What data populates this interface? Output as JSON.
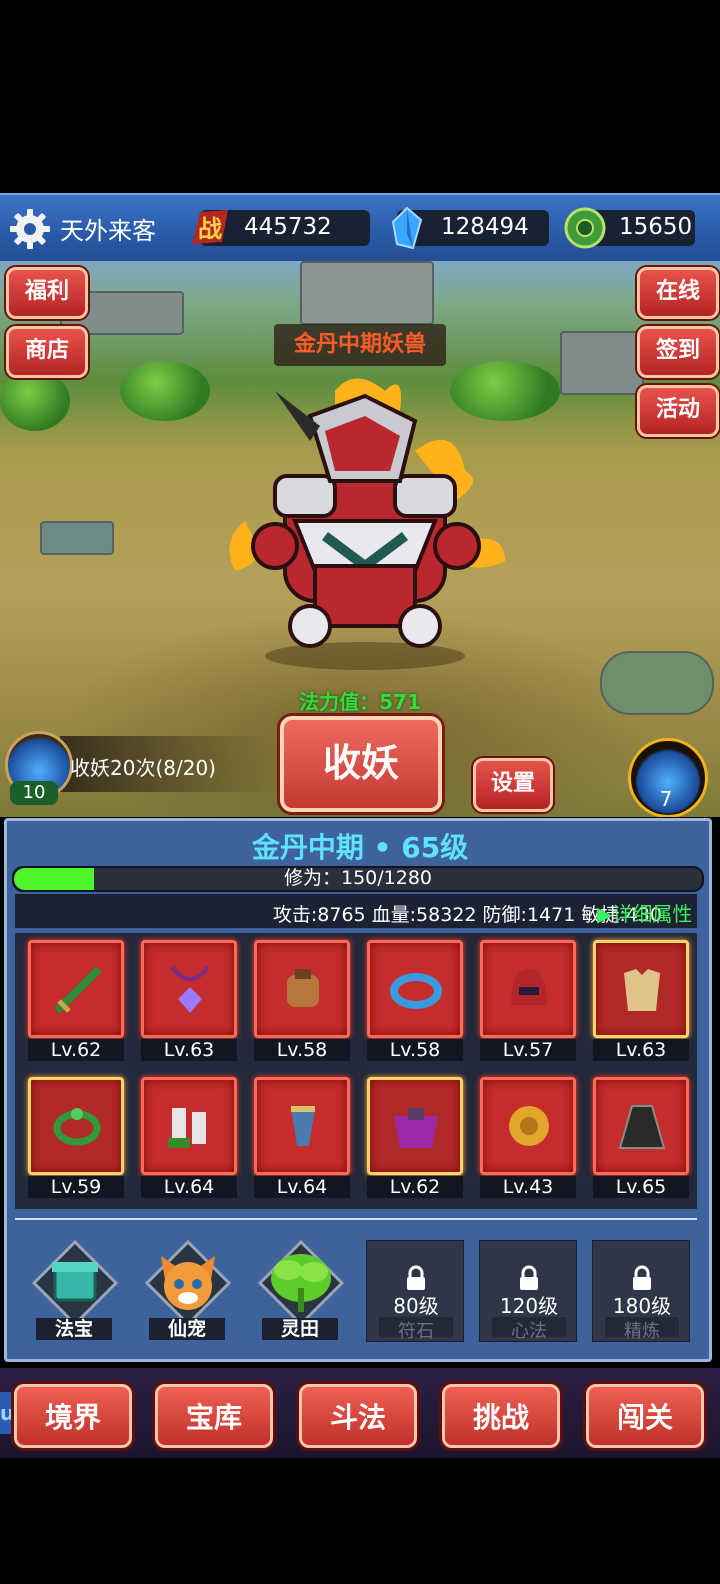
{
  "player": {
    "name": "天外来客"
  },
  "resources": [
    {
      "icon": "battle-power-icon",
      "value": "445732"
    },
    {
      "icon": "crystal-gem-icon",
      "value": "128494"
    },
    {
      "icon": "jade-coin-icon",
      "value": "15650"
    }
  ],
  "scene": {
    "left_buttons": [
      "福利",
      "商店"
    ],
    "right_buttons": [
      "在线",
      "签到",
      "活动"
    ],
    "monster_name": "金丹中期妖兽",
    "power_label": "法力值：571",
    "catch_info": "收妖20次(8/20)",
    "left_potion_count": "10",
    "catch_button": "收妖",
    "settings_button": "设置",
    "right_potion_count": "7"
  },
  "panel": {
    "realm_title": "金丹中期 • 65级",
    "cultivation": {
      "text": "修为：150/1280",
      "current": 150,
      "max": 1280
    },
    "stats": "攻击:8765   血量:58322   防御:1471   敏捷:430",
    "detail_link": "▶详细属性",
    "equipment": [
      {
        "icon": "sword-icon",
        "level": "Lv.62",
        "frame": "red"
      },
      {
        "icon": "amulet-icon",
        "level": "Lv.63",
        "frame": "red"
      },
      {
        "icon": "glove-icon",
        "level": "Lv.58",
        "frame": "red"
      },
      {
        "icon": "bracelet-icon",
        "level": "Lv.58",
        "frame": "red"
      },
      {
        "icon": "helmet-icon",
        "level": "Lv.57",
        "frame": "red"
      },
      {
        "icon": "armor-icon",
        "level": "Lv.63",
        "frame": "gold"
      },
      {
        "icon": "ring-icon",
        "level": "Lv.59",
        "frame": "gold"
      },
      {
        "icon": "boots-icon",
        "level": "Lv.64",
        "frame": "red"
      },
      {
        "icon": "bracer-icon",
        "level": "Lv.64",
        "frame": "red"
      },
      {
        "icon": "belt-icon",
        "level": "Lv.62",
        "frame": "gold"
      },
      {
        "icon": "medallion-icon",
        "level": "Lv.43",
        "frame": "red"
      },
      {
        "icon": "cloak-icon",
        "level": "Lv.65",
        "frame": "red"
      }
    ],
    "features": [
      {
        "icon": "treasure-icon",
        "name": "法宝"
      },
      {
        "icon": "cat-pet-icon",
        "name": "仙宠"
      },
      {
        "icon": "spirit-field-icon",
        "name": "灵田"
      }
    ],
    "locked_features": [
      {
        "level": "80级",
        "name": "符石"
      },
      {
        "level": "120级",
        "name": "心法"
      },
      {
        "level": "180级",
        "name": "精炼"
      }
    ]
  },
  "bottom_nav": {
    "up_tab": "up",
    "items": [
      "境界",
      "宝库",
      "斗法",
      "挑战",
      "闯关"
    ]
  },
  "colors": {
    "accent_red": "#c43a33",
    "panel_blue": "#3d629c",
    "title_cyan": "#5fe2ff",
    "xp_green": "#4ef52a"
  }
}
